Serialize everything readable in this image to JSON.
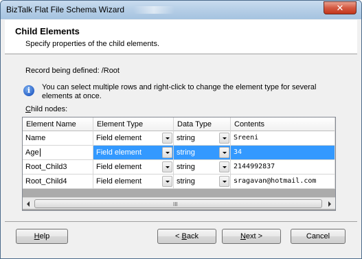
{
  "window": {
    "title": "BizTalk Flat File Schema Wizard",
    "close_glyph": "✕"
  },
  "header": {
    "title": "Child Elements",
    "subtitle": "Specify properties of the child elements."
  },
  "record": {
    "label": "Record being defined: /Root"
  },
  "info": {
    "icon": "info-icon",
    "icon_glyph": "i",
    "text": "You can select multiple rows and right-click to change the element type for several elements at once."
  },
  "grid": {
    "label_first": "C",
    "label_rest": "hild nodes:",
    "columns": [
      "Element Name",
      "Element Type",
      "Data Type",
      "Contents"
    ],
    "rows": [
      {
        "name": "Name",
        "element_type": "Field element",
        "data_type": "string",
        "contents": "Sreeni",
        "selected": false
      },
      {
        "name": "Age",
        "element_type": "Field element",
        "data_type": "string",
        "contents": "34",
        "selected": true
      },
      {
        "name": "Root_Child3",
        "element_type": "Field element",
        "data_type": "string",
        "contents": "2144992837",
        "selected": false
      },
      {
        "name": "Root_Child4",
        "element_type": "Field element",
        "data_type": "string",
        "contents": "sragavan@hotmail.com",
        "selected": false
      }
    ],
    "scroll_grip": "III"
  },
  "buttons": {
    "help": {
      "mnemonic": "H",
      "rest": "elp"
    },
    "back": {
      "prefix": "< ",
      "mnemonic": "B",
      "rest": "ack"
    },
    "next": {
      "mnemonic": "N",
      "rest": "ext >"
    },
    "cancel": {
      "label": "Cancel"
    }
  },
  "colors": {
    "selection": "#3399ff",
    "titlebar": "#b7cfe7",
    "close": "#c2361c"
  }
}
